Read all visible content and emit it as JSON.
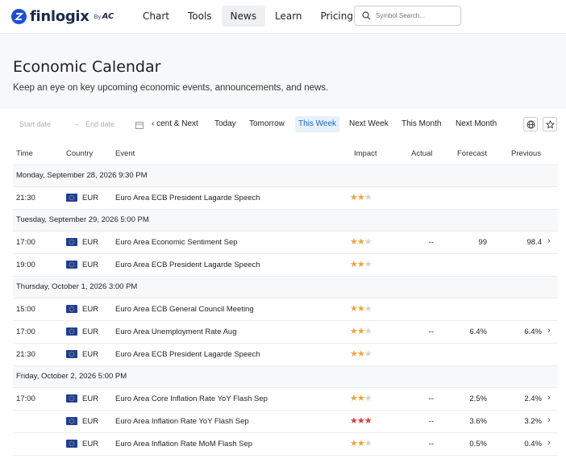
{
  "header": {
    "logo_text": "finlogix",
    "logo_by": "By",
    "logo_brand": "AC",
    "nav": [
      {
        "label": "Chart",
        "active": false
      },
      {
        "label": "Tools",
        "active": false
      },
      {
        "label": "News",
        "active": true
      },
      {
        "label": "Learn",
        "active": false
      },
      {
        "label": "Pricing",
        "active": false
      }
    ],
    "search": {
      "placeholder": "Symbol Search..."
    }
  },
  "hero": {
    "title": "Economic Calendar",
    "subtitle": "Keep an eye on key upcoming economic events, announcements, and news."
  },
  "filters": {
    "start_placeholder": "Start date",
    "arrow": "→",
    "end_placeholder": "End date",
    "quick": [
      {
        "label": "‹ cent & Next",
        "active": false
      },
      {
        "label": "Today",
        "active": false
      },
      {
        "label": "Tomorrow",
        "active": false
      },
      {
        "label": "This Week",
        "active": true
      },
      {
        "label": "Next Week",
        "active": false
      },
      {
        "label": "This Month",
        "active": false
      },
      {
        "label": "Next Month",
        "active": false
      }
    ],
    "icons": [
      "globe-icon",
      "star-icon"
    ]
  },
  "table": {
    "headers": {
      "time": "Time",
      "country": "Country",
      "event": "Event",
      "impact": "Impact",
      "actual": "Actual",
      "forecast": "Forecast",
      "previous": "Previous"
    },
    "groups": [
      {
        "label": "Monday, September 28, 2026 9:30 PM",
        "rows": [
          {
            "time": "21:30",
            "currency": "EUR",
            "event": "Euro Area ECB President Lagarde Speech",
            "impact": 2,
            "actual": "",
            "forecast": "",
            "previous": "",
            "chevron": false
          }
        ]
      },
      {
        "label": "Tuesday, September 29, 2026 5:00 PM",
        "rows": [
          {
            "time": "17:00",
            "currency": "EUR",
            "event": "Euro Area Economic Sentiment Sep",
            "impact": 2,
            "actual": "--",
            "forecast": "99",
            "previous": "98.4",
            "chevron": true
          },
          {
            "time": "19:00",
            "currency": "EUR",
            "event": "Euro Area ECB President Lagarde Speech",
            "impact": 2,
            "actual": "",
            "forecast": "",
            "previous": "",
            "chevron": false
          }
        ]
      },
      {
        "label": "Thursday, October 1, 2026 3:00 PM",
        "rows": [
          {
            "time": "15:00",
            "currency": "EUR",
            "event": "Euro Area ECB General Council Meeting",
            "impact": 2,
            "actual": "",
            "forecast": "",
            "previous": "",
            "chevron": false
          },
          {
            "time": "17:00",
            "currency": "EUR",
            "event": "Euro Area Unemployment Rate Aug",
            "impact": 2,
            "actual": "--",
            "forecast": "6.4%",
            "previous": "6.4%",
            "chevron": true
          },
          {
            "time": "21:30",
            "currency": "EUR",
            "event": "Euro Area ECB President Lagarde Speech",
            "impact": 2,
            "actual": "",
            "forecast": "",
            "previous": "",
            "chevron": false
          }
        ]
      },
      {
        "label": "Friday, October 2, 2026 5:00 PM",
        "rows": [
          {
            "time": "17:00",
            "currency": "EUR",
            "event": "Euro Area Core Inflation Rate YoY Flash Sep",
            "impact": 2,
            "actual": "--",
            "forecast": "2.5%",
            "previous": "2.4%",
            "chevron": true
          },
          {
            "time": "",
            "currency": "EUR",
            "event": "Euro Area Inflation Rate YoY Flash Sep",
            "impact": 3,
            "actual": "--",
            "forecast": "3.6%",
            "previous": "3.2%",
            "chevron": true
          },
          {
            "time": "",
            "currency": "EUR",
            "event": "Euro Area Inflation Rate MoM Flash Sep",
            "impact": 2,
            "actual": "--",
            "forecast": "0.5%",
            "previous": "0.4%",
            "chevron": true
          }
        ]
      }
    ]
  },
  "colors": {
    "brand": "#1a2b4c",
    "logo_mark": "#1d4ed8",
    "active_tab_bg": "#e7f1fb",
    "active_tab_text": "#1d64c4",
    "star_medium": "#f0a33a",
    "star_high": "#e0393e",
    "star_off": "#cfd2d6",
    "eu_flag": "#1f3d95"
  }
}
